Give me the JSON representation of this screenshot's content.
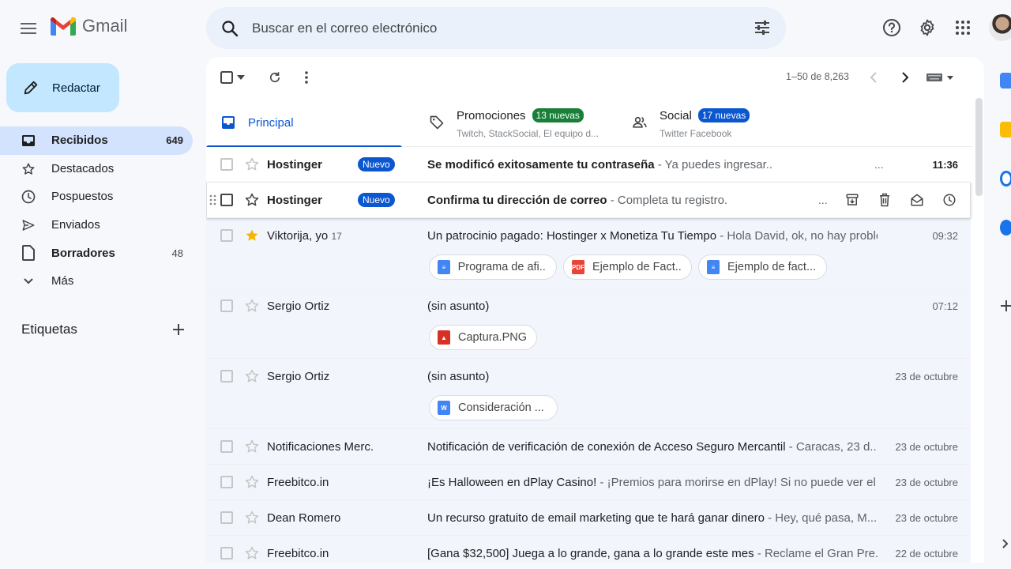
{
  "app": {
    "name": "Gmail"
  },
  "search": {
    "placeholder": "Buscar en el correo electrónico"
  },
  "compose": {
    "label": "Redactar"
  },
  "sidebar": {
    "items": [
      {
        "label": "Recibidos",
        "count": "649",
        "icon": "inbox-icon"
      },
      {
        "label": "Destacados",
        "count": "",
        "icon": "star-icon"
      },
      {
        "label": "Pospuestos",
        "count": "",
        "icon": "clock-icon"
      },
      {
        "label": "Enviados",
        "count": "",
        "icon": "send-icon"
      },
      {
        "label": "Borradores",
        "count": "48",
        "icon": "draft-icon"
      },
      {
        "label": "Más",
        "count": "",
        "icon": "chevron-down-icon"
      }
    ],
    "labels_title": "Etiquetas"
  },
  "toolbar": {
    "pager": "1–50 de 8,263"
  },
  "tabs": [
    {
      "label": "Principal",
      "icon": "inbox-icon"
    },
    {
      "label": "Promociones",
      "badge": "13 nuevas",
      "sub": "Twitch, StackSocial, El equipo d...",
      "badge_color": "#188038"
    },
    {
      "label": "Social",
      "badge": "17 nuevas",
      "sub": "Twitter Facebook",
      "badge_color": "#0b57d0"
    }
  ],
  "emails": [
    {
      "sender": "Hostinger",
      "badge": "Nuevo",
      "subject": "Se modificó exitosamente tu contraseña",
      "snippet": " - Ya puedes ingresar..",
      "date": "11:36",
      "unread": true,
      "starred": false
    },
    {
      "sender": "Hostinger",
      "badge": "Nuevo",
      "subject": "Confirma tu dirección de correo",
      "snippet": " - Completa tu registro.",
      "date": "",
      "unread": true,
      "starred": false
    },
    {
      "sender": "Viktorija, yo",
      "sender_count": "17",
      "subject": "Un patrocinio pagado: Hostinger x Monetiza Tu Tiempo",
      "snippet": " - Hola David, ok, no hay proble...",
      "date": "09:32",
      "unread": false,
      "starred": true,
      "attachments": [
        {
          "name": "Programa de afi...",
          "type": "doc"
        },
        {
          "name": "Ejemplo de Fact...",
          "type": "pdf"
        },
        {
          "name": "Ejemplo de fact...",
          "type": "doc"
        }
      ]
    },
    {
      "sender": "Sergio Ortiz",
      "subject": "(sin asunto)",
      "snippet": "",
      "date": "07:12",
      "unread": false,
      "starred": false,
      "attachments": [
        {
          "name": "Captura.PNG",
          "type": "image"
        }
      ]
    },
    {
      "sender": "Sergio Ortiz",
      "subject": "(sin asunto)",
      "snippet": "",
      "date": "23 de octubre",
      "unread": false,
      "starred": false,
      "attachments": [
        {
          "name": "Consideración ...",
          "type": "word"
        }
      ]
    },
    {
      "sender": "Notificaciones Merc.",
      "subject": "Notificación de verificación de conexión de Acceso Seguro Mercantil",
      "snippet": " - Caracas, 23 d...",
      "date": "23 de octubre",
      "unread": false,
      "starred": false
    },
    {
      "sender": "Freebitco.in",
      "subject": "¡Es Halloween en dPlay Casino!",
      "snippet": " - ¡Premios para morirse en dPlay! Si no puede ver el ...",
      "date": "23 de octubre",
      "unread": false,
      "starred": false
    },
    {
      "sender": "Dean Romero",
      "subject": "Un recurso gratuito de email marketing que te hará ganar dinero",
      "snippet": " - Hey, qué pasa, M...",
      "date": "23 de octubre",
      "unread": false,
      "starred": false
    },
    {
      "sender": "Freebitco.in",
      "subject": "[Gana $32,500] Juega a lo grande, gana a lo grande este mes",
      "snippet": " - Reclame el Gran Pre...",
      "date": "22 de octubre",
      "unread": false,
      "starred": false
    }
  ],
  "colors": {
    "accent": "#0b57d0",
    "compose_bg": "#c2e7ff",
    "active_nav": "#d3e3fd",
    "star": "#f4b400"
  }
}
